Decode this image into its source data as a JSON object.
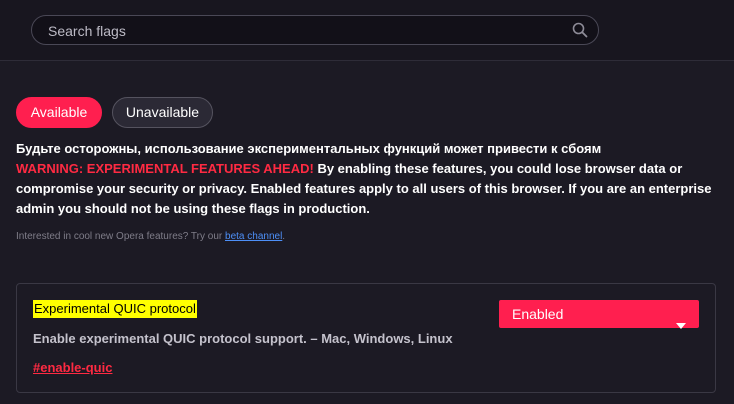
{
  "search": {
    "placeholder": "Search flags"
  },
  "tabs": [
    {
      "label": "Available",
      "active": true
    },
    {
      "label": "Unavailable",
      "active": false
    }
  ],
  "warning": {
    "russian_line": "Будьте осторожны, использование экспериментальных функций может привести к сбоям",
    "headline": "WARNING: EXPERIMENTAL FEATURES AHEAD!",
    "body": "By enabling these features, you could lose browser data or compromise your security or privacy. Enabled features apply to all users of this browser. If you are an enterprise admin you should not be using these flags in production."
  },
  "promo": {
    "text": "Interested in cool new Opera features? Try our",
    "link_label": "beta channel",
    "suffix": "."
  },
  "flag": {
    "title": "Experimental QUIC protocol",
    "description": "Enable experimental QUIC protocol support. – Mac, Windows, Linux",
    "anchor": "#enable-quic",
    "selected_value": "Enabled"
  },
  "colors": {
    "background": "#1c1a24",
    "accent": "#ff1f4f",
    "warning": "#ff2a42",
    "highlight": "#ffff00",
    "link": "#4d8ff7"
  },
  "icons": {
    "search": "search-icon",
    "dropdown": "caret-down-icon"
  }
}
